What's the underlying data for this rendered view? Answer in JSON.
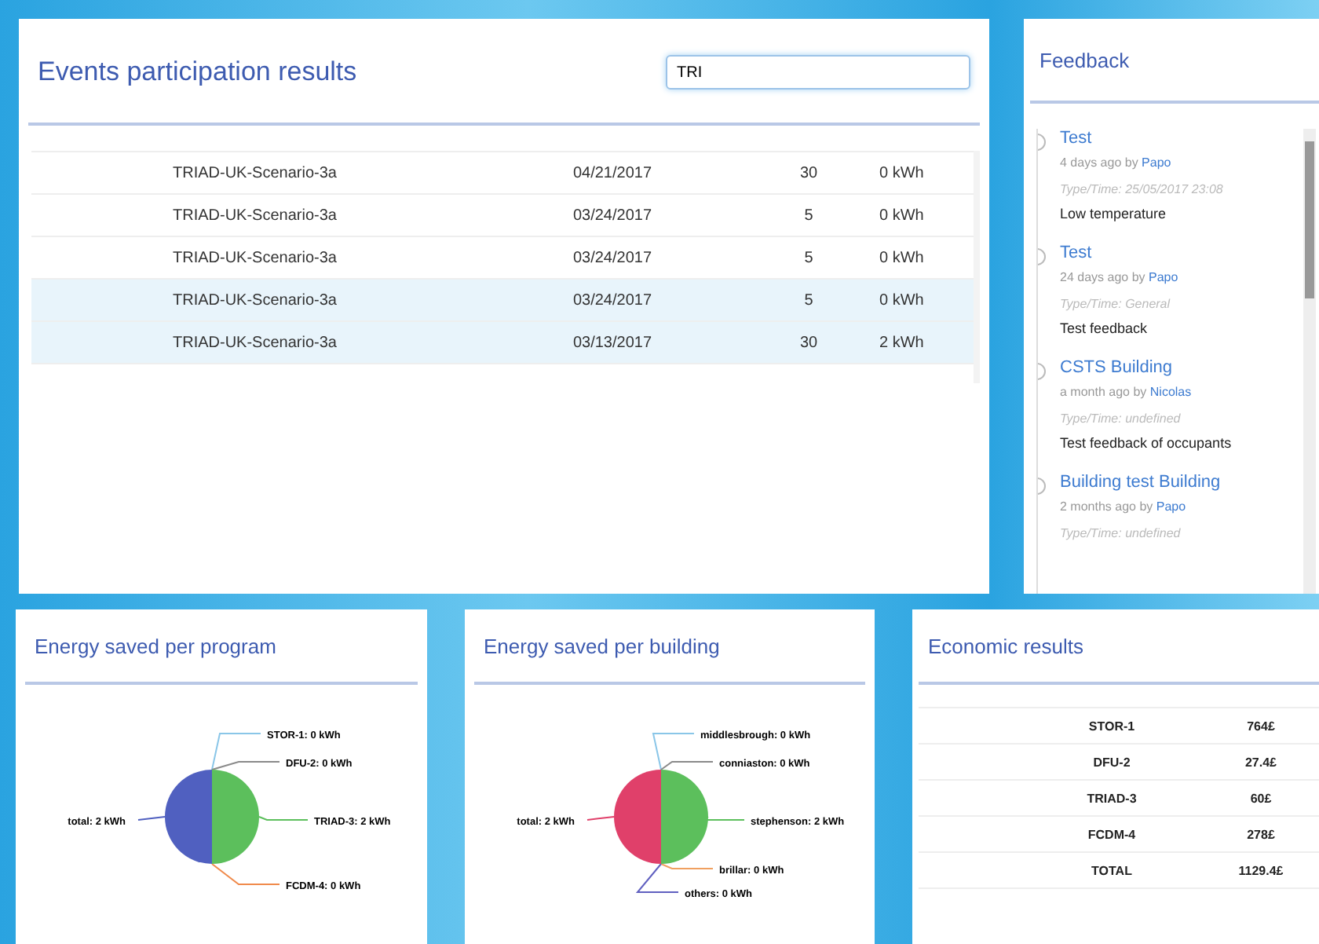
{
  "events": {
    "title": "Events participation results",
    "search": {
      "value": "TRI"
    },
    "rows": [
      [
        "TRIAD-UK-Scenario-3a",
        "04/21/2017",
        "30",
        "0 kWh"
      ],
      [
        "TRIAD-UK-Scenario-3a",
        "03/24/2017",
        "5",
        "0 kWh"
      ],
      [
        "TRIAD-UK-Scenario-3a",
        "03/24/2017",
        "5",
        "0 kWh"
      ],
      [
        "TRIAD-UK-Scenario-3a",
        "03/24/2017",
        "5",
        "0 kWh"
      ],
      [
        "TRIAD-UK-Scenario-3a",
        "03/13/2017",
        "30",
        "2 kWh"
      ]
    ]
  },
  "feedback": {
    "title": "Feedback",
    "items": [
      {
        "title": "Test",
        "ago": "4 days ago by",
        "author": "Papo",
        "type": "Type/Time: 25/05/2017 23:08",
        "text": "Low temperature"
      },
      {
        "title": "Test",
        "ago": "24 days ago by",
        "author": "Papo",
        "type": "Type/Time: General",
        "text": "Test feedback"
      },
      {
        "title": "CSTS Building",
        "ago": "a month ago by",
        "author": "Nicolas",
        "type": "Type/Time: undefined",
        "text": "Test feedback of occupants"
      },
      {
        "title": "Building test Building",
        "ago": "2 months ago by",
        "author": "Papo",
        "type": "Type/Time: undefined"
      }
    ]
  },
  "program_panel": {
    "title": "Energy saved per program",
    "chart_data": {
      "type": "pie",
      "categories": [
        "total: 2 kWh",
        "STOR-1: 0 kWh",
        "DFU-2: 0 kWh",
        "TRIAD-3: 2 kWh",
        "FCDM-4: 0 kWh"
      ],
      "series": [
        {
          "values": [
            50,
            0,
            0,
            50,
            0
          ]
        }
      ],
      "colors": [
        "#5060c0",
        "#8ac6e8",
        "#8a8a8a",
        "#5cbf5c",
        "#f08a4b"
      ]
    }
  },
  "building_panel": {
    "title": "Energy saved per building",
    "chart_data": {
      "type": "pie",
      "categories": [
        "total: 2 kWh",
        "middlesbrough: 0 kWh",
        "conniaston: 0 kWh",
        "stephenson: 2 kWh",
        "brillar: 0 kWh",
        "others: 0 kWh"
      ],
      "series": [
        {
          "values": [
            50,
            0,
            0,
            50,
            0,
            0
          ]
        }
      ],
      "colors": [
        "#e0406a",
        "#8ac6e8",
        "#8a8a8a",
        "#5cbf5c",
        "#f0a060",
        "#6060c0"
      ]
    }
  },
  "economic": {
    "title": "Economic results",
    "rows": [
      [
        "STOR-1",
        "764£"
      ],
      [
        "DFU-2",
        "27.4£"
      ],
      [
        "TRIAD-3",
        "60£"
      ],
      [
        "FCDM-4",
        "278£"
      ],
      [
        "TOTAL",
        "1129.4£"
      ]
    ]
  }
}
